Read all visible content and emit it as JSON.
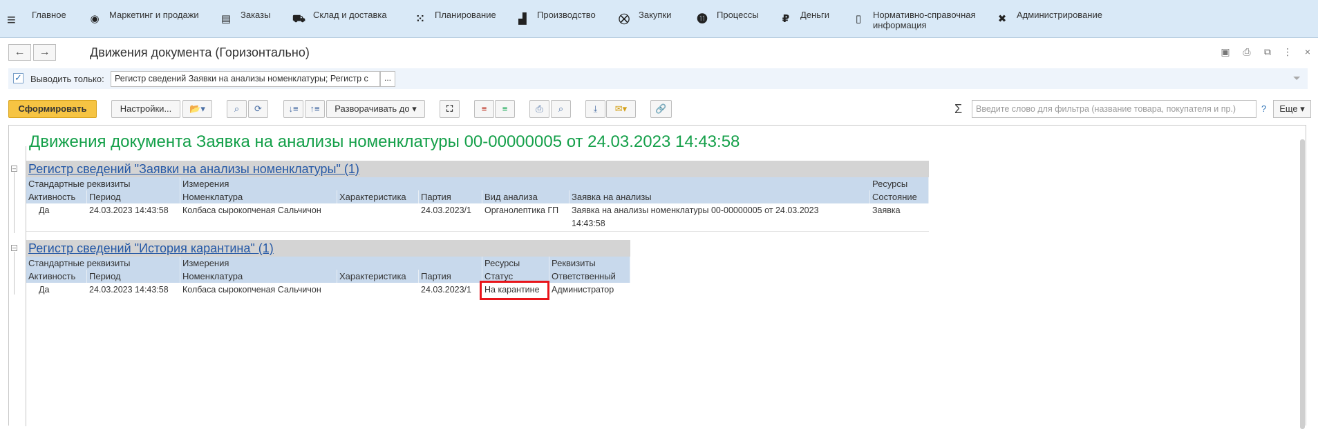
{
  "sections": [
    {
      "label": "Главное",
      "icon": "home-icon"
    },
    {
      "label": "Маркетинг и продажи",
      "icon": "marketing-icon"
    },
    {
      "label": "Заказы",
      "icon": "orders-icon"
    },
    {
      "label": "Склад и доставка",
      "icon": "truck-icon"
    },
    {
      "label": "Планирование",
      "icon": "planning-icon"
    },
    {
      "label": "Производство",
      "icon": "factory-icon"
    },
    {
      "label": "Закупки",
      "icon": "cart-icon"
    },
    {
      "label": "Процессы",
      "icon": "processes-icon"
    },
    {
      "label": "Деньги",
      "icon": "ruble-icon"
    },
    {
      "label": "Нормативно-справочная",
      "label2": "информация",
      "icon": "reference-book-icon"
    },
    {
      "label": "Администрирование",
      "icon": "tools-icon"
    }
  ],
  "header": {
    "title": "Движения документа (Горизонтально)"
  },
  "filter": {
    "label": "Выводить только:",
    "value": "Регистр сведений Заявки на анализы номенклатуры; Регистр с",
    "more": "..."
  },
  "toolbar": {
    "generate": "Сформировать",
    "settings": "Настройки...",
    "expand": "Разворачивать до",
    "search_placeholder": "Введите слово для фильтра (название товара, покупателя и пр.)",
    "help": "?",
    "more": "Еще"
  },
  "report": {
    "title": "Движения документа Заявка на анализы номенклатуры 00-00000005 от 24.03.2023 14:43:58",
    "register1": {
      "name": "Регистр сведений \"Заявки на анализы номенклатуры\" (1)",
      "group_headers": [
        "Стандартные реквизиты",
        "Измерения",
        "Ресурсы"
      ],
      "columns": [
        "Активность",
        "Период",
        "Номенклатура",
        "Характеристика",
        "Партия",
        "Вид анализа",
        "Заявка на анализы",
        "Состояние"
      ],
      "row": [
        "Да",
        "24.03.2023 14:43:58",
        "Колбаса сырокопченая Сальчичон",
        "",
        "24.03.2023/1",
        "Органолептика ГП",
        "Заявка на анализы номенклатуры 00-00000005 от 24.03.2023",
        "Заявка"
      ],
      "row_wrap": "14:43:58"
    },
    "register2": {
      "name": "Регистр сведений \"История карантина\" (1)",
      "group_headers": [
        "Стандартные реквизиты",
        "Измерения",
        "Ресурсы",
        "Реквизиты"
      ],
      "columns": [
        "Активность",
        "Период",
        "Номенклатура",
        "Характеристика",
        "Партия",
        "Статус",
        "Ответственный"
      ],
      "row": [
        "Да",
        "24.03.2023 14:43:58",
        "Колбаса сырокопченая Сальчичон",
        "",
        "24.03.2023/1",
        "На карантине",
        "Администратор"
      ]
    }
  },
  "colors": {
    "accent_green": "#15a04a",
    "link_blue": "#2458a6",
    "highlight_red": "#e8141a",
    "primary_button": "#f6c443"
  }
}
